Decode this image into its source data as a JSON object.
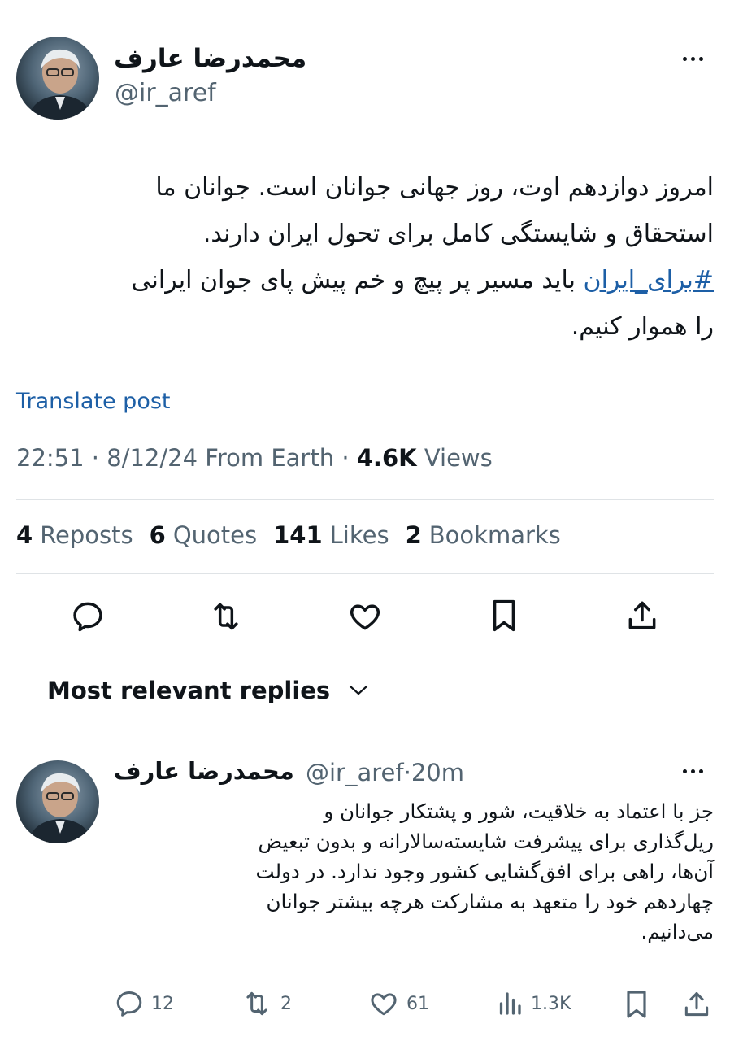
{
  "post": {
    "author_name": "محمدرضا عارف",
    "author_handle": "@ir_aref",
    "text_lines": [
      "امروز دوازدهم اوت، روز جهانی جوانان است. جوانان ما",
      "استحقاق و شایستگی کامل برای تحول ایران دارند."
    ],
    "hashtag": "#برای_ایران",
    "line3_rest": " باید مسیر پر پیچ و خم پیش پای جوان ایرانی",
    "line4": "را هموار کنیم.",
    "translate_label": "Translate post",
    "time": "22:51",
    "date": "8/12/24",
    "source": "From Earth",
    "views_count": "4.6K",
    "views_label": "Views",
    "stats": {
      "reposts_count": "4",
      "reposts_label": "Reposts",
      "quotes_count": "6",
      "quotes_label": "Quotes",
      "likes_count": "141",
      "likes_label": "Likes",
      "bookmarks_count": "2",
      "bookmarks_label": "Bookmarks"
    },
    "icons": [
      "reply-icon",
      "repost-icon",
      "like-icon",
      "bookmark-icon",
      "share-icon"
    ]
  },
  "replies_filter": {
    "label": "Most relevant replies",
    "icon": "chevron-down-icon"
  },
  "reply": {
    "author_name": "محمدرضا عارف",
    "author_handle": "@ir_aref",
    "sep": "·",
    "time_ago": "20m",
    "text_lines": [
      "جز با اعتماد به خلاقیت، شور و پشتکار جوانان و",
      "ریل‌گذاری برای پیشرفت شایسته‌سالارانه و بدون تبعیض",
      "آن‌ها، راهی برای افق‌گشایی کشور وجود ندارد. در دولت",
      "چهاردهم خود را متعهد به مشارکت هرچه بیشتر جوانان",
      "می‌دانیم."
    ],
    "actions": {
      "replies": "12",
      "reposts": "2",
      "likes": "61",
      "views": "1.3K"
    }
  },
  "colors": {
    "link": "#1d5fa6",
    "secondary": "#536471",
    "divider": "#dfe3e6"
  }
}
